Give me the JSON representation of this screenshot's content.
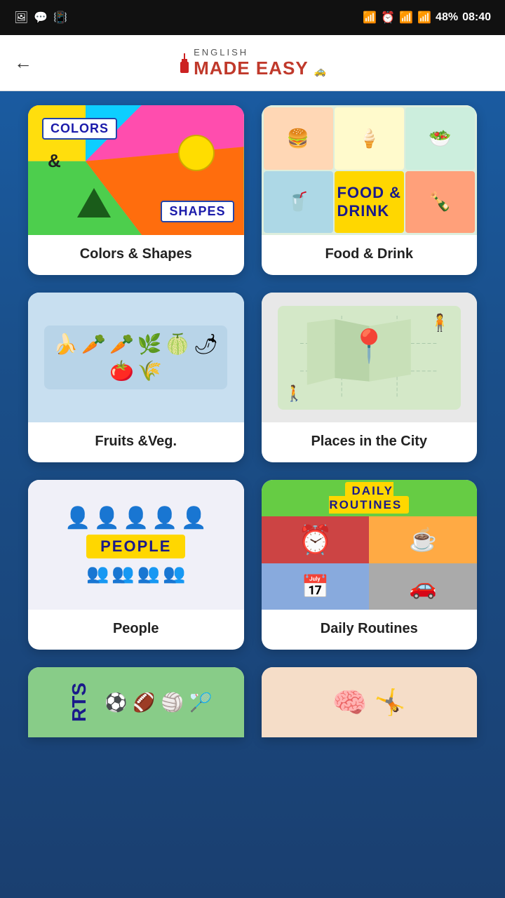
{
  "statusBar": {
    "leftIcons": [
      "🖼",
      "💬",
      "📳"
    ],
    "battery": "48%",
    "time": "08:40",
    "bluetooth": "⚡",
    "alarm": "⏰",
    "signal": "📶"
  },
  "header": {
    "backLabel": "←",
    "logoSmall": "ENGLISH",
    "logoBig1": "MADE ",
    "logoBig2": "EASY"
  },
  "categories": [
    {
      "id": "colors-shapes",
      "label": "Colors & Shapes",
      "type": "colors-shapes"
    },
    {
      "id": "food-drink",
      "label": "Food & Drink",
      "type": "food-drink"
    },
    {
      "id": "fruits-veg",
      "label": "Fruits &Veg.",
      "type": "fruits-veg"
    },
    {
      "id": "places-city",
      "label": "Places in the City",
      "type": "places-city"
    },
    {
      "id": "people",
      "label": "People",
      "type": "people"
    },
    {
      "id": "daily-routines",
      "label": "Daily Routines",
      "type": "daily-routines"
    },
    {
      "id": "sports",
      "label": "Sports",
      "type": "sports"
    },
    {
      "id": "body",
      "label": "Body",
      "type": "body"
    }
  ]
}
